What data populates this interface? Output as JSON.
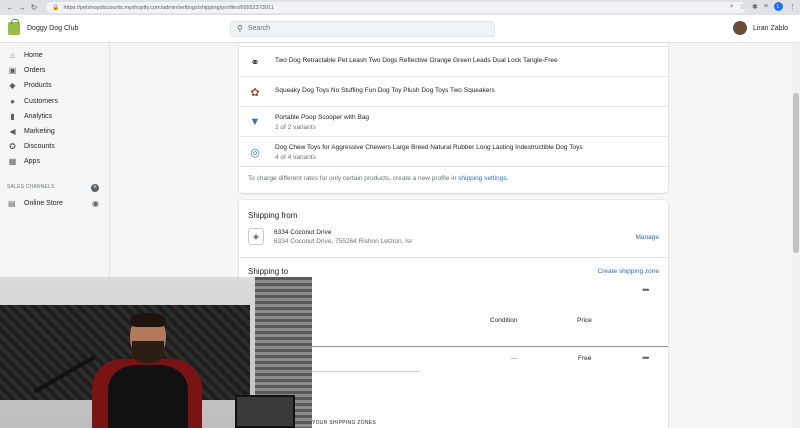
{
  "browser": {
    "url": "https://petshopdiscounts.myshopify.com/admin/settings/shipping/profiles/69552373911",
    "profile_initial": "L"
  },
  "topbar": {
    "store_name": "Doggy Dog Club",
    "search_placeholder": "Search",
    "user_name": "Liran Zablo"
  },
  "sidebar": {
    "items": [
      {
        "label": "Home",
        "icon": "home-icon"
      },
      {
        "label": "Orders",
        "icon": "orders-icon"
      },
      {
        "label": "Products",
        "icon": "tag-icon"
      },
      {
        "label": "Customers",
        "icon": "person-icon"
      },
      {
        "label": "Analytics",
        "icon": "bar-chart-icon"
      },
      {
        "label": "Marketing",
        "icon": "megaphone-icon"
      },
      {
        "label": "Discounts",
        "icon": "discount-icon"
      },
      {
        "label": "Apps",
        "icon": "apps-icon"
      }
    ],
    "channels_heading": "SALES CHANNELS",
    "online_store": "Online Store"
  },
  "products": [
    {
      "title": "Two Dog Retractable Pet Leash Two Dogs Reflective Orange Green Leads Dual Lock Tangle-Free",
      "variants": ""
    },
    {
      "title": "Squeaky Dog Toys No Stuffing Fun Dog Toy Plush Dog Toys Two Squeakers",
      "variants": ""
    },
    {
      "title": "Portable Poop Scooper with Bag",
      "variants": "2 of 2 variants"
    },
    {
      "title": "Dog Chew Toys for Aggressive Chewers Large Breed Natural Rubber Long Lasting Indestructible Dog Toys",
      "variants": "4 of 4 variants"
    }
  ],
  "hint": {
    "text": "To charge different rates for only certain products, create a new profile in ",
    "link": "shipping settings",
    "end": "."
  },
  "shipping_from": {
    "title": "Shipping from",
    "line1": "6334 Coconut Drive",
    "line2": "6334 Coconut Drive, 755264 Rishon Letzion, Isr",
    "manage": "Manage"
  },
  "shipping_to": {
    "title": "Shipping to",
    "create_zone": "Create shipping zone",
    "columns": {
      "condition": "Condition",
      "price": "Price"
    },
    "row": {
      "condition": "—",
      "price": "Free"
    },
    "zones_heading": "YOUR SHIPPING ZONES"
  },
  "colors": {
    "accent": "#2c6ecb",
    "shopify_green": "#95bf47"
  }
}
